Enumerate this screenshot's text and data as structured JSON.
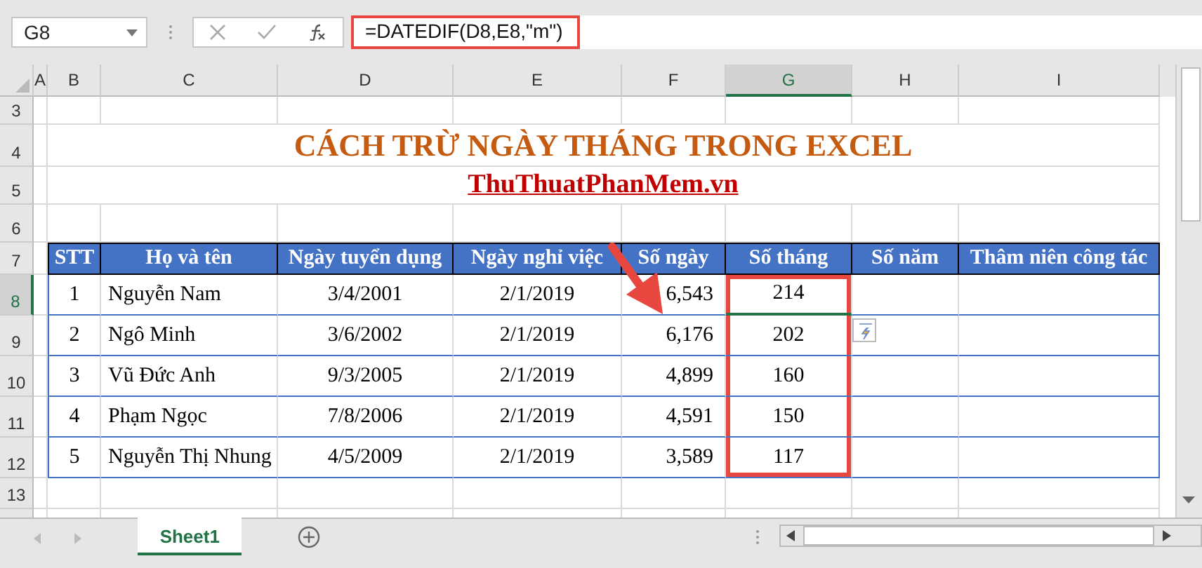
{
  "name_box": {
    "value": "G8"
  },
  "formula_bar": {
    "value": "=DATEDIF(D8,E8,\"m\")",
    "highlighted": true
  },
  "column_headers": [
    {
      "label": "A",
      "selected": false
    },
    {
      "label": "B",
      "selected": false
    },
    {
      "label": "C",
      "selected": false
    },
    {
      "label": "D",
      "selected": false
    },
    {
      "label": "E",
      "selected": false
    },
    {
      "label": "F",
      "selected": false
    },
    {
      "label": "G",
      "selected": true
    },
    {
      "label": "H",
      "selected": false
    },
    {
      "label": "I",
      "selected": false
    }
  ],
  "row_numbers": [
    {
      "label": "3",
      "selected": false
    },
    {
      "label": "4",
      "selected": false
    },
    {
      "label": "5",
      "selected": false
    },
    {
      "label": "6",
      "selected": false
    },
    {
      "label": "7",
      "selected": false
    },
    {
      "label": "8",
      "selected": true
    },
    {
      "label": "9",
      "selected": false
    },
    {
      "label": "10",
      "selected": false
    },
    {
      "label": "11",
      "selected": false
    },
    {
      "label": "12",
      "selected": false
    },
    {
      "label": "13",
      "selected": false
    }
  ],
  "title": "CÁCH TRỪ NGÀY THÁNG TRONG EXCEL",
  "subtitle": "ThuThuatPhanMem.vn",
  "table": {
    "columns": [
      "STT",
      "Họ và tên",
      "Ngày tuyển dụng",
      "Ngày nghỉ việc",
      "Số ngày",
      "Số tháng",
      "Số năm",
      "Thâm niên công tác"
    ],
    "rows": [
      [
        "1",
        "Nguyễn Nam",
        "3/4/2001",
        "2/1/2019",
        "6,543",
        "214",
        "",
        ""
      ],
      [
        "2",
        "Ngô Minh",
        "3/6/2002",
        "2/1/2019",
        "6,176",
        "202",
        "",
        ""
      ],
      [
        "3",
        "Vũ Đức Anh",
        "9/3/2005",
        "2/1/2019",
        "4,899",
        "160",
        "",
        ""
      ],
      [
        "4",
        "Phạm Ngọc",
        "7/8/2006",
        "2/1/2019",
        "4,591",
        "150",
        "",
        ""
      ],
      [
        "5",
        "Nguyễn Thị Nhung",
        "4/5/2009",
        "2/1/2019",
        "3,589",
        "117",
        "",
        ""
      ]
    ]
  },
  "sheet_tabs": [
    {
      "label": "Sheet1",
      "selected": true
    }
  ]
}
